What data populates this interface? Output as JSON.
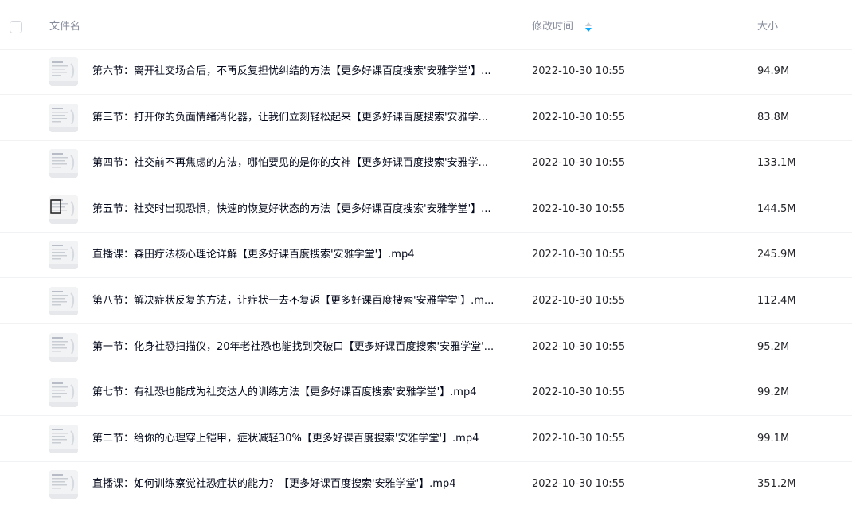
{
  "header": {
    "name_label": "文件名",
    "time_label": "修改时间",
    "size_label": "大小",
    "sort_icon": "sort-icon",
    "sort_color": "#06a7ff"
  },
  "files": [
    {
      "name": "第六节：离开社交场合后，不再反复担忧纠结的方法【更多好课百度搜索'安雅学堂'】...",
      "time": "2022-10-30 10:55",
      "size": "94.9M",
      "icon": "video-thumbnail"
    },
    {
      "name": "第三节：打开你的负面情绪消化器，让我们立刻轻松起来【更多好课百度搜索'安雅学...",
      "time": "2022-10-30 10:55",
      "size": "83.8M",
      "icon": "video-thumbnail"
    },
    {
      "name": "第四节：社交前不再焦虑的方法，哪怕要见的是你的女神【更多好课百度搜索'安雅学...",
      "time": "2022-10-30 10:55",
      "size": "133.1M",
      "icon": "video-thumbnail"
    },
    {
      "name": "第五节：社交时出现恐惧，快速的恢复好状态的方法【更多好课百度搜索'安雅学堂'】...",
      "time": "2022-10-30 10:55",
      "size": "144.5M",
      "icon": "video-thumbnail"
    },
    {
      "name": "直播课：森田疗法核心理论详解【更多好课百度搜索'安雅学堂'】.mp4",
      "time": "2022-10-30 10:55",
      "size": "245.9M",
      "icon": "video-thumbnail"
    },
    {
      "name": "第八节：解决症状反复的方法，让症状一去不复返【更多好课百度搜索'安雅学堂'】.m...",
      "time": "2022-10-30 10:55",
      "size": "112.4M",
      "icon": "video-thumbnail"
    },
    {
      "name": "第一节：化身社恐扫描仪，20年老社恐也能找到突破口【更多好课百度搜索'安雅学堂'...",
      "time": "2022-10-30 10:55",
      "size": "95.2M",
      "icon": "video-thumbnail"
    },
    {
      "name": "第七节：有社恐也能成为社交达人的训练方法【更多好课百度搜索'安雅学堂'】.mp4",
      "time": "2022-10-30 10:55",
      "size": "99.2M",
      "icon": "video-thumbnail"
    },
    {
      "name": "第二节：给你的心理穿上铠甲，症状减轻30%【更多好课百度搜索'安雅学堂'】.mp4",
      "time": "2022-10-30 10:55",
      "size": "99.1M",
      "icon": "video-thumbnail"
    },
    {
      "name": "直播课：如何训练察觉社恐症状的能力？【更多好课百度搜索'安雅学堂'】.mp4",
      "time": "2022-10-30 10:55",
      "size": "351.2M",
      "icon": "video-thumbnail"
    }
  ]
}
